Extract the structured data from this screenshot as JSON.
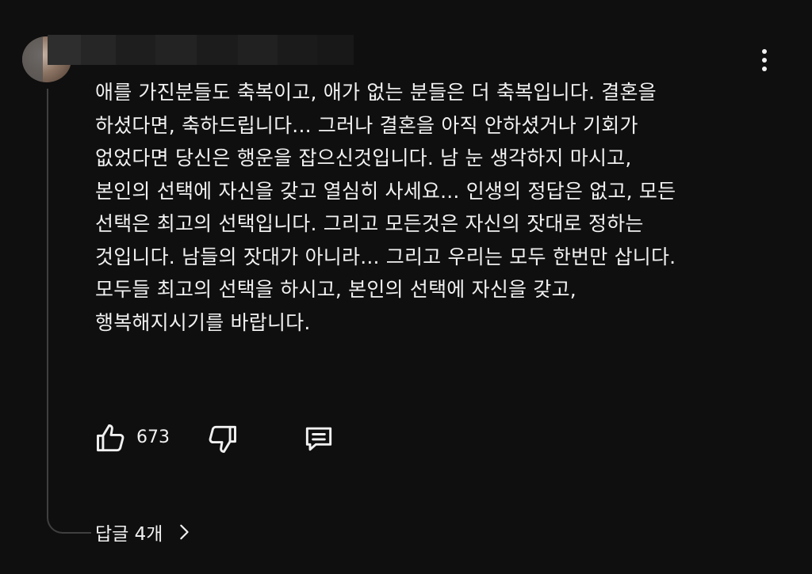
{
  "comment": {
    "lines": [
      "애를 가진분들도 축복이고, 애가 없는 분들은  더 축복입니다.   결혼을",
      "하셨다면, 축하드립니다... 그러나 결혼을 아직 안하셨거나 기회가",
      "없었다면 당신은 행운을 잡으신것입니다.  남 눈 생각하지 마시고,",
      "본인의 선택에 자신을 갖고 열심히 사세요... 인생의 정답은 없고, 모든",
      "선택은 최고의 선택입니다.  그리고 모든것은 자신의 잣대로 정하는",
      "것입니다. 남들의 잣대가 아니라... 그리고 우리는 모두 한번만 삽니다.",
      "모두들 최고의 선택을 하시고, 본인의 선택에 자신을 갖고,",
      "행복해지시기를 바랍니다."
    ],
    "like_count": "673",
    "replies_label": "답글 4개"
  },
  "icons": {
    "like": "thumbs-up-icon",
    "dislike": "thumbs-down-icon",
    "reply": "reply-comment-icon",
    "more": "more-vertical-icon",
    "chevron": "chevron-right-icon"
  },
  "colors": {
    "background": "#0f0f0f",
    "text": "#f1f1f1",
    "thread_line": "#3f3f3f"
  }
}
